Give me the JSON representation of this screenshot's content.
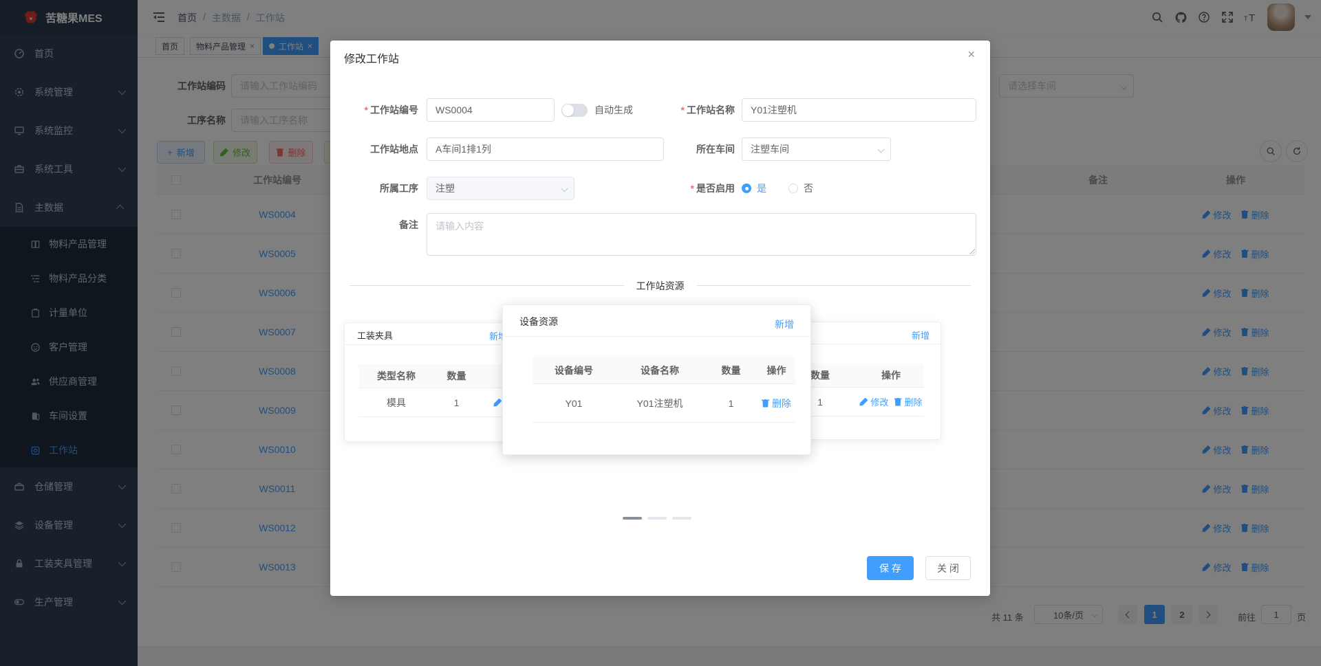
{
  "colors": {
    "primary": "#409EFF",
    "success": "#67C23A",
    "danger": "#F56C6C",
    "warning": "#E6A23C",
    "sidebar_bg": "#304156",
    "submenu_bg": "#1f2d3d"
  },
  "sidebar": {
    "logo_text": "苦糖果MES",
    "items_top": [
      {
        "label": "首页"
      },
      {
        "label": "系统管理"
      },
      {
        "label": "系统监控"
      },
      {
        "label": "系统工具"
      }
    ],
    "master_data_label": "主数据",
    "sub_items": [
      {
        "label": "物料产品管理"
      },
      {
        "label": "物料产品分类"
      },
      {
        "label": "计量单位"
      },
      {
        "label": "客户管理"
      },
      {
        "label": "供应商管理"
      },
      {
        "label": "车间设置"
      },
      {
        "label": "工作站"
      }
    ],
    "items_bottom": [
      {
        "label": "仓储管理"
      },
      {
        "label": "设备管理"
      },
      {
        "label": "工装夹具管理"
      },
      {
        "label": "生产管理"
      }
    ]
  },
  "header": {
    "sep": "/",
    "breadcrumb": [
      "首页",
      "主数据",
      "工作站"
    ],
    "icons": [
      "search",
      "github",
      "help",
      "fullscreen",
      "font-size",
      "avatar",
      "caret-down"
    ]
  },
  "tags": {
    "home": "首页",
    "materials": "物料产品管理",
    "workstation": "工作站",
    "close_symbol": "×"
  },
  "filter": {
    "code_label": "工作站编码",
    "code_placeholder": "请输入工作站编码",
    "process_label": "工序名称",
    "process_placeholder": "请输入工序名称",
    "workshop_placeholder": "请选择车间"
  },
  "toolbar": {
    "plus_sign": "+",
    "add": "新增",
    "edit": "修改",
    "delete": "删除",
    "hidden": ""
  },
  "table": {
    "col_code": "工作站编号",
    "col_remark": "备注",
    "col_action": "操作",
    "edit": "修改",
    "delete": "删除",
    "rows": [
      {
        "code": "WS0004"
      },
      {
        "code": "WS0005"
      },
      {
        "code": "WS0006"
      },
      {
        "code": "WS0007"
      },
      {
        "code": "WS0008"
      },
      {
        "code": "WS0009"
      },
      {
        "code": "WS0010"
      },
      {
        "code": "WS0011"
      },
      {
        "code": "WS0012"
      },
      {
        "code": "WS0013"
      }
    ]
  },
  "pagination": {
    "total": "共 11 条",
    "size": "10条/页",
    "page1": "1",
    "page2": "2",
    "goto_label": "前往",
    "goto_value": "1",
    "page_unit": "页"
  },
  "dialog": {
    "title": "修改工作站",
    "close_symbol": "×",
    "required_mark": "*",
    "fields": {
      "code_label": "工作站编号",
      "code_value": "WS0004",
      "auto_generate": "自动生成",
      "name_label": "工作站名称",
      "name_value": "Y01注塑机",
      "location_label": "工作站地点",
      "location_value": "A车间1排1列",
      "workshop_label": "所在车间",
      "workshop_value": "注塑车间",
      "process_label": "所属工序",
      "process_value": "注塑",
      "enabled_label": "是否启用",
      "enabled_yes": "是",
      "enabled_no": "否",
      "remark_label": "备注",
      "remark_placeholder": "请输入内容"
    },
    "divider_text": "工作站资源",
    "cards": {
      "fixture": {
        "title": "工装夹具",
        "add": "新增",
        "col_type": "类型名称",
        "col_qty": "数量",
        "row_type": "模具",
        "row_qty": "1",
        "edit": "修改"
      },
      "device": {
        "title": "设备资源",
        "add": "新增",
        "col_code": "设备编号",
        "col_name": "设备名称",
        "col_qty": "数量",
        "col_action": "操作",
        "row_code": "Y01",
        "row_name": "Y01注塑机",
        "row_qty": "1",
        "delete": "删除"
      },
      "third": {
        "title": "",
        "add": "新增",
        "col_qty": "数量",
        "col_action": "操作",
        "row_qty": "1",
        "edit": "修改",
        "delete": "删除"
      }
    },
    "save_label": "保 存",
    "close_label": "关 闭"
  }
}
